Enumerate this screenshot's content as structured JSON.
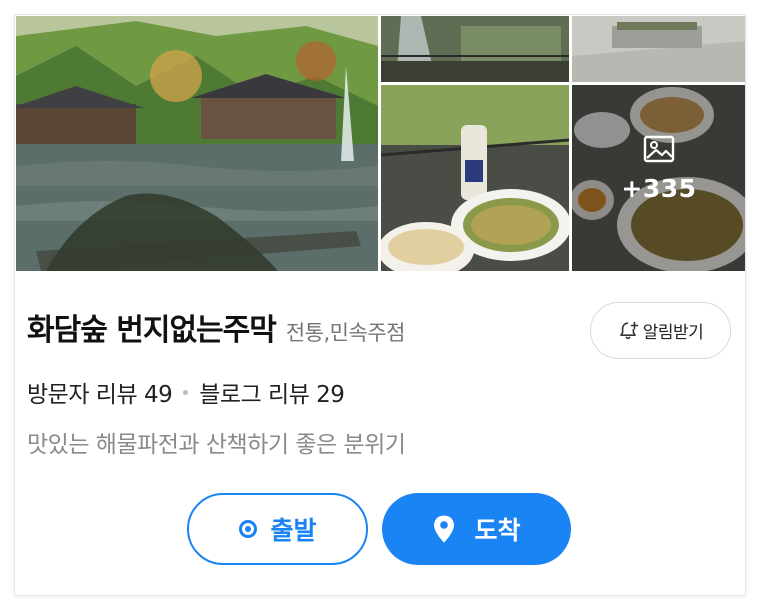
{
  "place": {
    "name": "화담숲 번지없는주막",
    "category": "전통,민속주점"
  },
  "alarm": {
    "label": "알림받기",
    "icon": "bell-plus-icon"
  },
  "reviews": {
    "visitor_label": "방문자 리뷰",
    "visitor_count": "49",
    "blog_label": "블로그 리뷰",
    "blog_count": "29"
  },
  "summary": "맛있는 해물파전과 산책하기 좋은 분위기",
  "photos": {
    "more_count": "+335",
    "more_icon": "gallery-icon"
  },
  "actions": {
    "depart_label": "출발",
    "arrive_label": "도착",
    "depart_icon": "origin-dot-icon",
    "arrive_icon": "pin-icon"
  },
  "colors": {
    "accent": "#1a84f5",
    "muted_text": "#8a8a8a",
    "category_text": "#767676"
  }
}
